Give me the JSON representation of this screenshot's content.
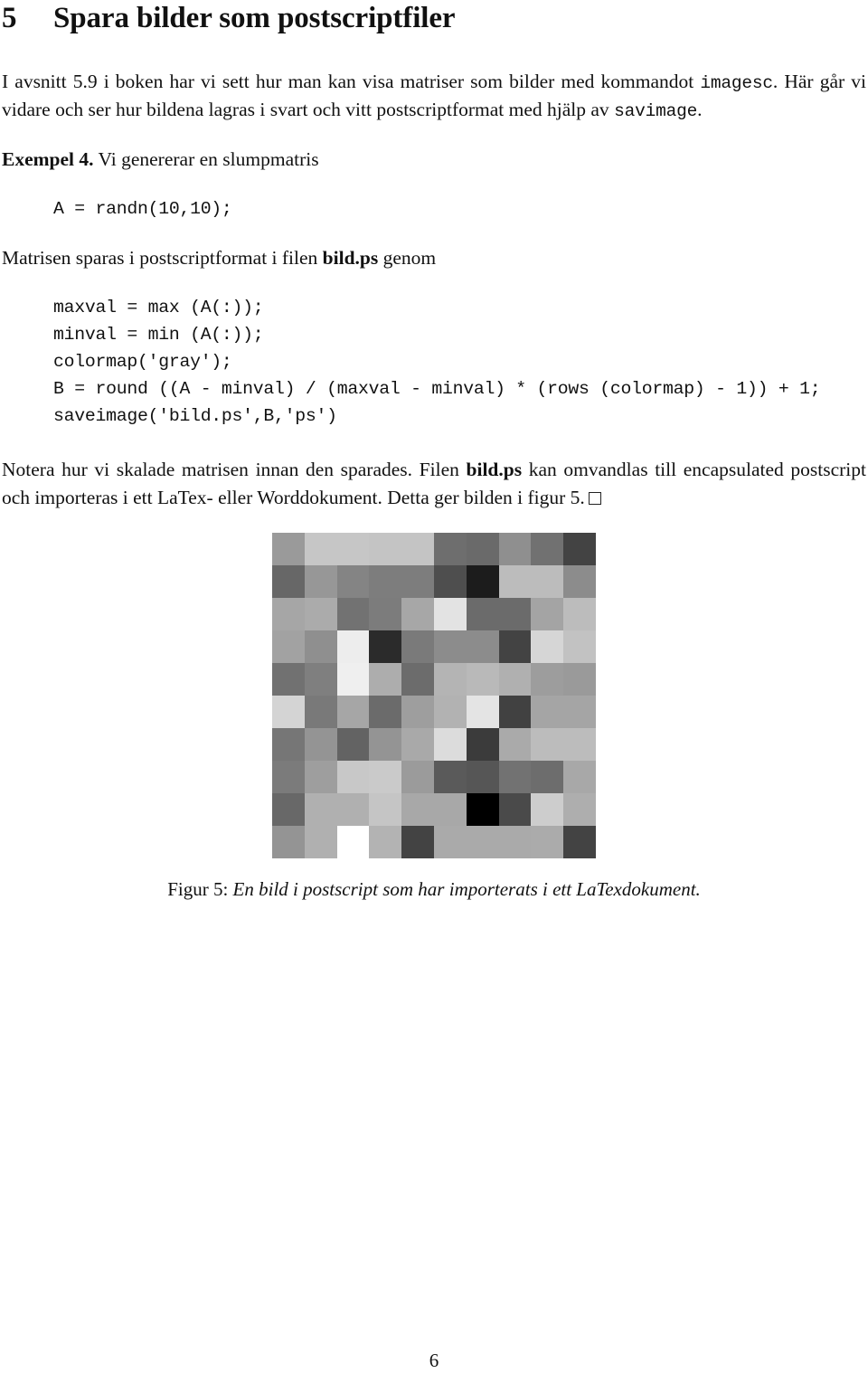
{
  "document": {
    "section": {
      "number": "5",
      "title": "Spara bilder som postscriptfiler"
    },
    "intro": {
      "part1": "I avsnitt 5.9 i boken har vi sett hur man kan visa matriser som bilder med kommandot ",
      "code1": "imagesc",
      "part2": ". Här går vi vidare och ser hur bildena lagras i svart och vitt postscriptformat med hjälp av ",
      "code2": "savimage",
      "part3": "."
    },
    "example": {
      "label": "Exempel 4.",
      "text": " Vi genererar en slumpmatris",
      "code": "A = randn(10,10);"
    },
    "saved_intro": {
      "part1": "Matrisen sparas i postscriptformat i filen ",
      "filename": "bild.ps",
      "part2": " genom"
    },
    "code_block": "maxval = max (A(:));\nminval = min (A(:));\ncolormap('gray');\nB = round ((A - minval) / (maxval - minval) * (rows (colormap) - 1)) + 1;\nsaveimage('bild.ps',B,'ps')",
    "closing": {
      "part1": "Notera hur vi skalade matrisen innan den sparades. Filen ",
      "filename": "bild.ps",
      "part2": " kan omvandlas till encapsulated postscript och importeras i ett LaTex- eller Worddokument. Detta ger bilden i figur 5."
    },
    "figure": {
      "caption_label": "Figur 5: ",
      "caption_text": "En bild i postscript som har importerats i ett LaTexdokument.",
      "alt": "10x10 grayscale random matrix image"
    },
    "page_number": "6"
  },
  "chart_data": {
    "type": "heatmap",
    "title": "En bild i postscript som har importerats i ett LaTexdokument.",
    "rows": 10,
    "cols": 10,
    "colormap": "gray",
    "xlabel": "",
    "ylabel": "",
    "grid": false,
    "legend": "none",
    "values": [
      [
        "#9a9a9a",
        "#c6c6c6",
        "#c6c6c6",
        "#c4c4c4",
        "#c4c4c4",
        "#6e6e6e",
        "#6a6a6a",
        "#8f8f8f",
        "#717171",
        "#434343"
      ],
      [
        "#676767",
        "#979797",
        "#848484",
        "#7d7d7d",
        "#7d7d7d",
        "#4e4e4e",
        "#1c1c1c",
        "#bcbcbc",
        "#bcbcbc",
        "#8c8c8c"
      ],
      [
        "#a6a6a6",
        "#ababab",
        "#727272",
        "#7c7c7c",
        "#a7a7a7",
        "#e3e3e3",
        "#6b6b6b",
        "#6b6b6b",
        "#a4a4a4",
        "#bcbcbc"
      ],
      [
        "#a2a2a2",
        "#8f8f8f",
        "#ededed",
        "#2b2b2b",
        "#7a7a7a",
        "#8c8c8c",
        "#8c8c8c",
        "#434343",
        "#d6d6d6",
        "#c2c2c2"
      ],
      [
        "#717171",
        "#7f7f7f",
        "#efefef",
        "#adadad",
        "#6c6c6c",
        "#b4b4b4",
        "#b9b9b9",
        "#b0b0b0",
        "#9d9d9d",
        "#9a9a9a"
      ],
      [
        "#d4d4d4",
        "#797979",
        "#a6a6a6",
        "#6b6b6b",
        "#9e9e9e",
        "#b2b2b2",
        "#e4e4e4",
        "#414141",
        "#a5a5a5",
        "#a5a5a5"
      ],
      [
        "#767676",
        "#949494",
        "#636363",
        "#949494",
        "#a9a9a9",
        "#dcdcdc",
        "#3b3b3b",
        "#aaaaaa",
        "#bcbcbc",
        "#bcbcbc"
      ],
      [
        "#7b7b7b",
        "#9e9e9e",
        "#c8c8c8",
        "#cacaca",
        "#9b9b9b",
        "#5a5a5a",
        "#565656",
        "#727272",
        "#6d6d6d",
        "#a8a8a8"
      ],
      [
        "#686868",
        "#b0b0b0",
        "#b0b0b0",
        "#c5c5c5",
        "#a8a8a8",
        "#a8a8a8",
        "#000000",
        "#4a4a4a",
        "#cdcdcd",
        "#aeaeae"
      ],
      [
        "#949494",
        "#b0b0b0",
        "#ffffff",
        "#b3b3b3",
        "#434343",
        "#aaaaaa",
        "#aaaaaa",
        "#aaaaaa",
        "#ababab",
        "#434343"
      ]
    ]
  }
}
